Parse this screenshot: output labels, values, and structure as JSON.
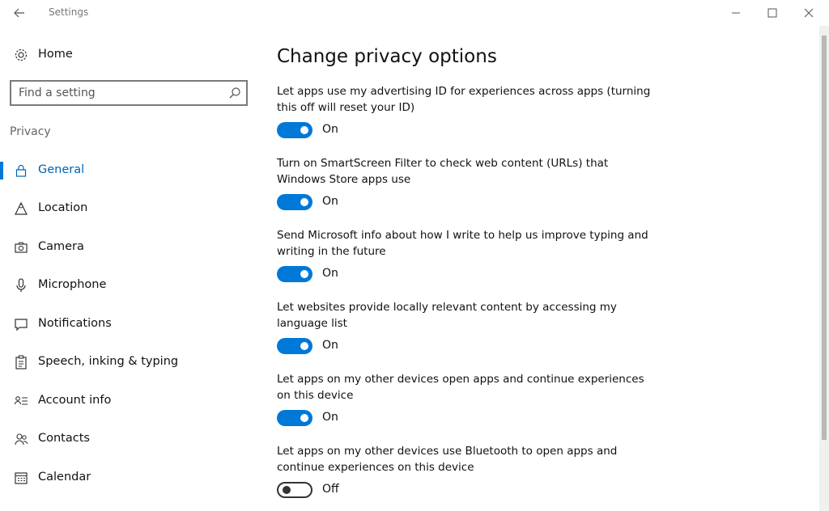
{
  "window": {
    "title": "Settings",
    "back_icon": "back-arrow-icon",
    "controls": [
      "minimize-icon",
      "maximize-icon",
      "close-icon"
    ]
  },
  "sidebar": {
    "home_label": "Home",
    "search_placeholder": "Find a setting",
    "section_heading": "Privacy",
    "items": [
      {
        "label": "General",
        "icon": "lock-icon",
        "active": true
      },
      {
        "label": "Location",
        "icon": "location-icon",
        "active": false
      },
      {
        "label": "Camera",
        "icon": "camera-icon",
        "active": false
      },
      {
        "label": "Microphone",
        "icon": "microphone-icon",
        "active": false
      },
      {
        "label": "Notifications",
        "icon": "notifications-icon",
        "active": false
      },
      {
        "label": "Speech, inking & typing",
        "icon": "clipboard-icon",
        "active": false
      },
      {
        "label": "Account info",
        "icon": "account-info-icon",
        "active": false
      },
      {
        "label": "Contacts",
        "icon": "contacts-icon",
        "active": false
      },
      {
        "label": "Calendar",
        "icon": "calendar-icon",
        "active": false
      }
    ]
  },
  "main": {
    "title": "Change privacy options",
    "settings": [
      {
        "description": "Let apps use my advertising ID for experiences across apps (turning this off will reset your ID)",
        "state": "On"
      },
      {
        "description": "Turn on SmartScreen Filter to check web content (URLs) that Windows Store apps use",
        "state": "On"
      },
      {
        "description": "Send Microsoft info about how I write to help us improve typing and writing in the future",
        "state": "On"
      },
      {
        "description": "Let websites provide locally relevant content by accessing my language list",
        "state": "On"
      },
      {
        "description": "Let apps on my other devices open apps and continue experiences on this device",
        "state": "On"
      },
      {
        "description": "Let apps on my other devices use Bluetooth to open apps and continue experiences on this device",
        "state": "Off"
      }
    ]
  },
  "colors": {
    "accent": "#0078d7",
    "text": "#111111",
    "muted": "#666666"
  }
}
